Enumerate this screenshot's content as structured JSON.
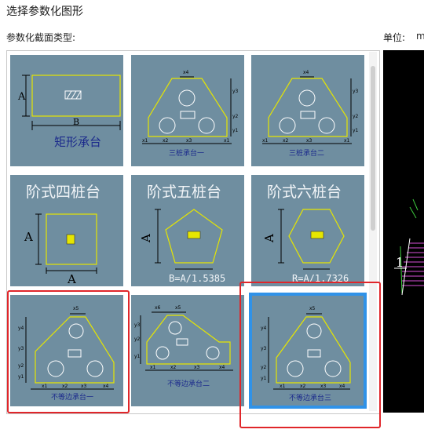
{
  "dialog": {
    "title": "选择参数化图形"
  },
  "section": {
    "label": "参数化截面类型:"
  },
  "unit": {
    "label": "单位:",
    "value": "m"
  },
  "cells": [
    {
      "id": "rect",
      "title": "矩形承台",
      "dims": [
        "A",
        "B"
      ]
    },
    {
      "id": "tri-pile-1",
      "title": "三桩承台一",
      "dims": [
        "x4",
        "y3",
        "y2",
        "y1",
        "x1",
        "x2",
        "x3",
        "x1"
      ]
    },
    {
      "id": "tri-pile-2",
      "title": "三桩承台二",
      "dims": [
        "x4",
        "y3",
        "y2",
        "y1",
        "x1",
        "x2",
        "x3",
        "x1"
      ]
    },
    {
      "id": "step-4",
      "title": "阶式四桩台",
      "dims": [
        "A",
        "A"
      ]
    },
    {
      "id": "step-5",
      "title": "阶式五桩台",
      "dims": [
        "A",
        "B=A/1.5385"
      ]
    },
    {
      "id": "step-6",
      "title": "阶式六桩台",
      "dims": [
        "A",
        "R=A/1.7326"
      ]
    },
    {
      "id": "uneq-1",
      "title": "不等边承台一",
      "dims": [
        "x5",
        "y4",
        "y3",
        "y2",
        "y1",
        "x1",
        "x2",
        "x3",
        "x4"
      ]
    },
    {
      "id": "uneq-2",
      "title": "不等边承台二",
      "dims": [
        "x6",
        "x5",
        "y3",
        "y2",
        "y1",
        "x1",
        "x2",
        "x3",
        "x4"
      ]
    },
    {
      "id": "uneq-3",
      "title": "不等边承台三",
      "dims": [
        "x5",
        "y4",
        "y3",
        "y2",
        "y1",
        "x1",
        "x2",
        "x3",
        "x4"
      ]
    }
  ],
  "selected": "不等边承台三",
  "colors": {
    "cell_bg": "#6f8ea0",
    "outline": "#e6e600",
    "selected_border": "#2f92e8",
    "highlight": "#e0262a"
  },
  "preview": {
    "label": "1"
  }
}
